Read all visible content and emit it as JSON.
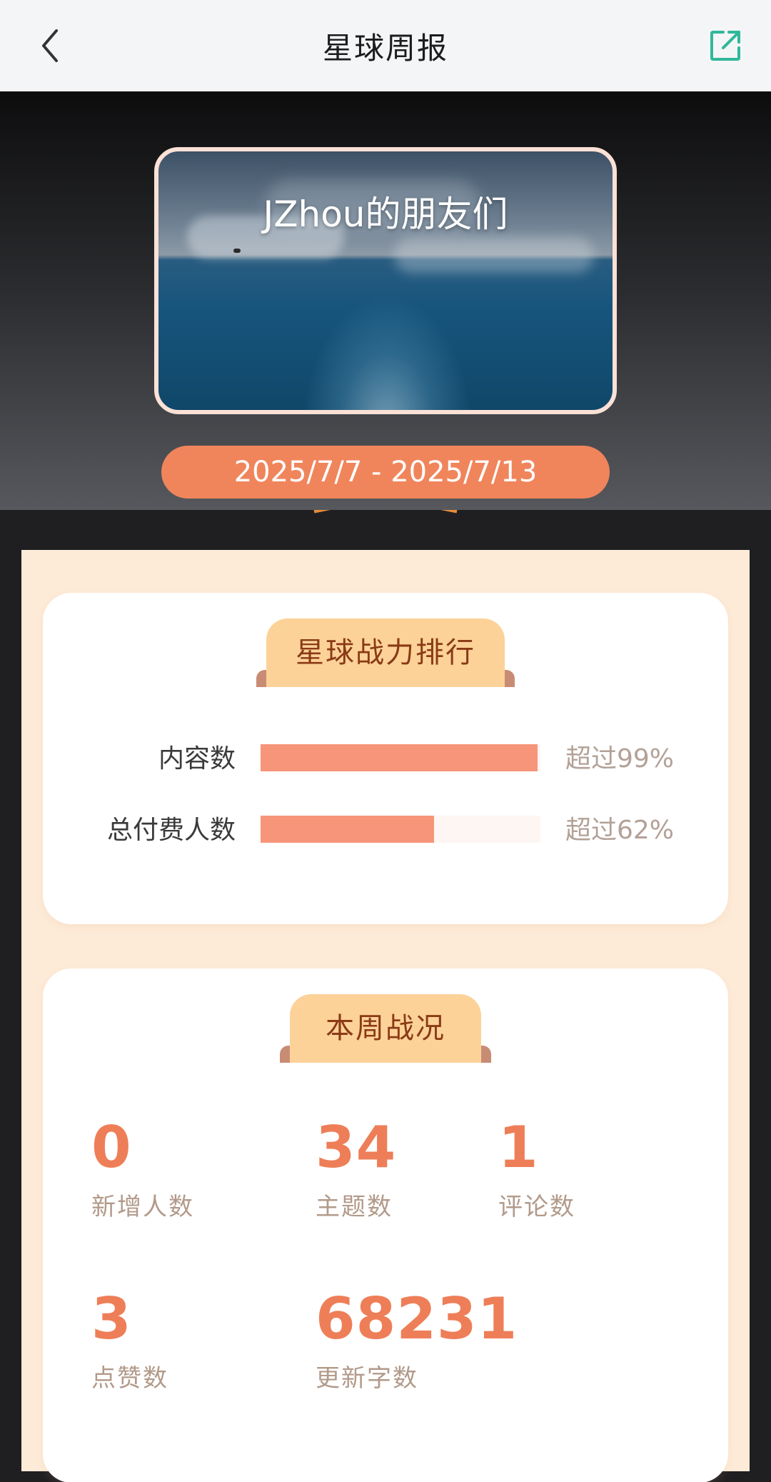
{
  "nav": {
    "title": "星球周报"
  },
  "cover": {
    "title": "JZhou的朋友们"
  },
  "date_range": "2025/7/7 - 2025/7/13",
  "ranking": {
    "title": "星球战力排行",
    "rows": [
      {
        "label": "内容数",
        "value": "超过99%",
        "percent": 99
      },
      {
        "label": "总付费人数",
        "value": "超过62%",
        "percent": 62
      }
    ]
  },
  "weekly": {
    "title": "本周战况",
    "stats": [
      {
        "number": "0",
        "label": "新增人数"
      },
      {
        "number": "34",
        "label": "主题数"
      },
      {
        "number": "1",
        "label": "评论数"
      },
      {
        "number": "3",
        "label": "点赞数"
      },
      {
        "number": "68231",
        "label": "更新字数"
      }
    ]
  },
  "colors": {
    "accent": "#f0855c",
    "bar": "#f7957a",
    "stat_number": "#ee7e58",
    "share_icon": "#2fb89a"
  }
}
